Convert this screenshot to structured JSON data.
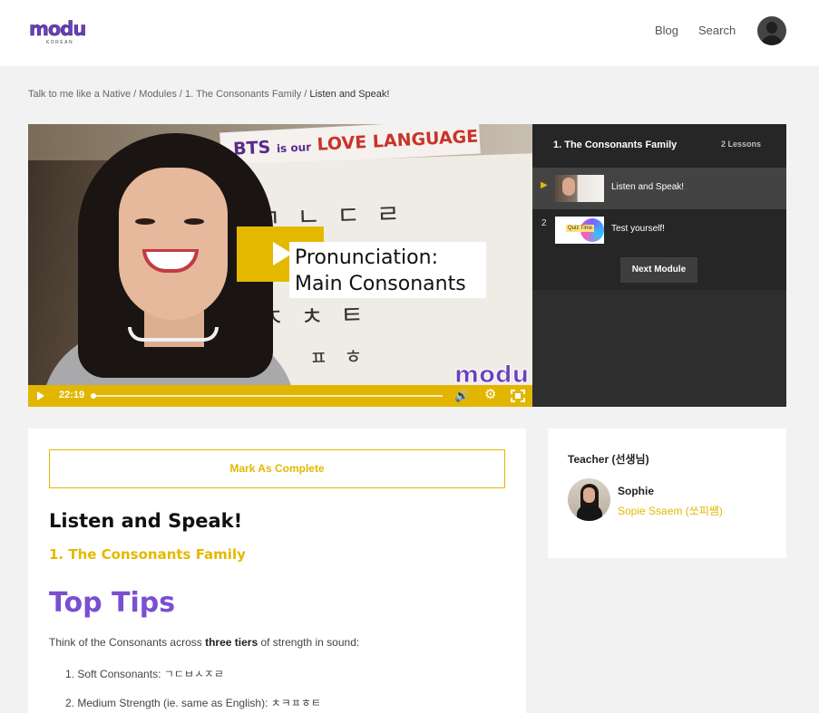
{
  "header": {
    "logo_text": "modu",
    "logo_subtext": "KOREAN",
    "nav": [
      "Blog",
      "Search"
    ]
  },
  "breadcrumb": {
    "items": [
      "Talk to me like a Native",
      "Modules",
      "1. The Consonants Family"
    ],
    "separator": " / ",
    "current": "Listen and Speak!"
  },
  "video": {
    "banner_bts": "BTS",
    "banner_is_our": "is our",
    "banner_love": "LOVE LANGUAGE",
    "board_row1": "ㄱㄴㄷㄹ",
    "board_row2": "ㅈㅊㅌ",
    "board_row3": "ㅍㅎ",
    "title_line1": "Pronunciation:",
    "title_line2": "Main Consonants",
    "watermark": "modu",
    "time": "22:19",
    "progress": 0.0
  },
  "lesson_panel": {
    "title": "1. The Consonants Family",
    "count": "2 Lessons",
    "lessons": [
      {
        "marker": "▶",
        "label": "Listen and Speak!",
        "active": true
      },
      {
        "marker": "2",
        "label": "Test yourself!",
        "thumb_text": "Quiz Time",
        "active": false
      }
    ],
    "next_button": "Next Module"
  },
  "content": {
    "mark_complete": "Mark As Complete",
    "lesson_title": "Listen and Speak!",
    "module_title": "1. The Consonants Family",
    "tips_title": "Top Tips",
    "intro_before": "Think of the Consonants across ",
    "intro_bold": "three tiers",
    "intro_after": " of strength in sound:",
    "list": [
      "1. Soft Consonants: ㄱㄷㅂㅅㅈㄹ",
      "2. Medium Strength (ie. same as English): ㅊㅋㅍㅎㅌ"
    ]
  },
  "teacher": {
    "heading": "Teacher (선생님)",
    "name": "Sophie",
    "subtitle": "Sopie Ssaem (쏘피쌤)"
  },
  "colors": {
    "accent_yellow": "#e5b800",
    "accent_purple": "#7a4fd0",
    "panel_dark": "#2e2e2e"
  }
}
